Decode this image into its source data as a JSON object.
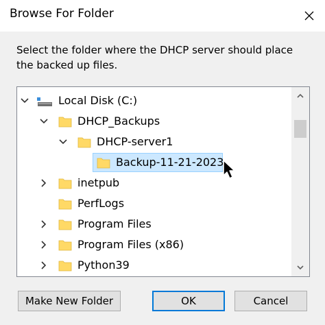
{
  "window": {
    "title": "Browse For Folder"
  },
  "instruction": "Select the folder where the DHCP server should place the backed up files.",
  "tree": {
    "items": [
      {
        "label": "Local Disk (C:)",
        "icon": "drive-icon",
        "expanded": true,
        "level": 0
      },
      {
        "label": "DHCP_Backups",
        "icon": "folder-icon",
        "expanded": true,
        "level": 1
      },
      {
        "label": "DHCP-server1",
        "icon": "folder-icon",
        "expanded": true,
        "level": 2
      },
      {
        "label": "Backup-11-21-2023",
        "icon": "folder-icon",
        "selected": true,
        "level": 3
      },
      {
        "label": "inetpub",
        "icon": "folder-icon",
        "expanded": false,
        "level": 1
      },
      {
        "label": "PerfLogs",
        "icon": "folder-icon",
        "level": 1
      },
      {
        "label": "Program Files",
        "icon": "folder-icon",
        "expanded": false,
        "level": 1
      },
      {
        "label": "Program Files (x86)",
        "icon": "folder-icon",
        "expanded": false,
        "level": 1
      },
      {
        "label": "Python39",
        "icon": "folder-icon",
        "expanded": false,
        "level": 1
      }
    ]
  },
  "buttons": {
    "make_new_folder": "Make New Folder",
    "ok": "OK",
    "cancel": "Cancel"
  },
  "colors": {
    "selection_bg": "#cce8ff",
    "selection_border": "#99d1ff",
    "folder": "#ffd966",
    "default_button_border": "#0078d7"
  }
}
